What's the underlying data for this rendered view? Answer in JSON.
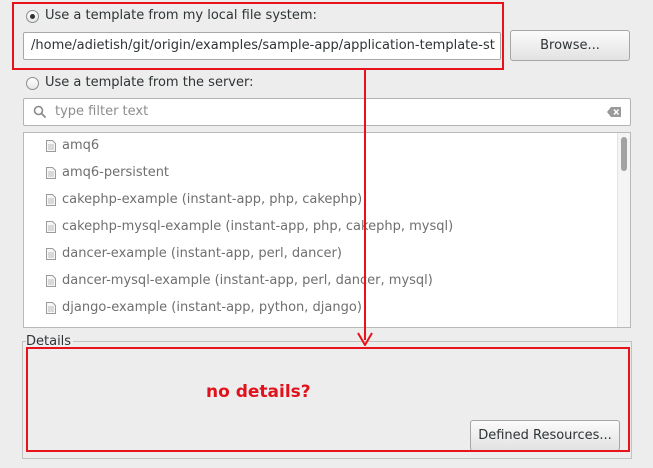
{
  "local_option": {
    "label": "Use a template from my local file system:",
    "selected": true
  },
  "path_value": "/home/adietish/git/origin/examples/sample-app/application-template-st",
  "browse_label": "Browse...",
  "server_option": {
    "label": "Use a template from the server:",
    "selected": false
  },
  "filter_placeholder": "type filter text",
  "templates": [
    "amq6",
    "amq6-persistent",
    "cakephp-example (instant-app, php, cakephp)",
    "cakephp-mysql-example (instant-app, php, cakephp, mysql)",
    "dancer-example (instant-app, perl, dancer)",
    "dancer-mysql-example (instant-app, perl, dancer, mysql)",
    "django-example (instant-app, python, django)"
  ],
  "details_label": "Details",
  "annotation_text": "no details?",
  "defined_resources_label": "Defined Resources...",
  "colors": {
    "annotation_red": "#e8121b",
    "background": "#ededed"
  }
}
